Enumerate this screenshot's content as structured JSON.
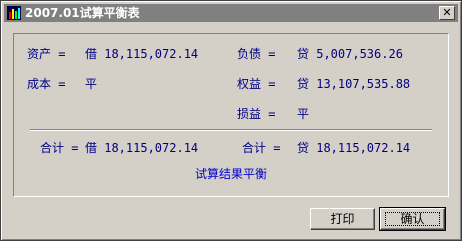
{
  "window": {
    "title": "2007.01试算平衡表",
    "close_glyph": "✕"
  },
  "balance": {
    "assets": {
      "label": "资产 =",
      "value": "借 18,115,072.14"
    },
    "liabilities": {
      "label": "负债 =",
      "value": "贷 5,007,536.26"
    },
    "cost": {
      "label": "成本 =",
      "value": "平"
    },
    "equity": {
      "label": "权益 =",
      "value": "贷 13,107,535.88"
    },
    "profit_loss": {
      "label": "损益 =",
      "value": "平"
    },
    "total_left": {
      "label": "合计 =",
      "value": "借 18,115,072.14"
    },
    "total_right": {
      "label": "合计 =",
      "value": "贷 18,115,072.14"
    }
  },
  "result_text": "试算结果平衡",
  "buttons": {
    "print": "打印",
    "ok": "确认"
  },
  "icons": {
    "app": "chart-bars-icon",
    "close": "close-icon"
  },
  "colors": {
    "text_navy": "#000080",
    "result_blue": "#0000cc",
    "title_bar": "#808080"
  }
}
